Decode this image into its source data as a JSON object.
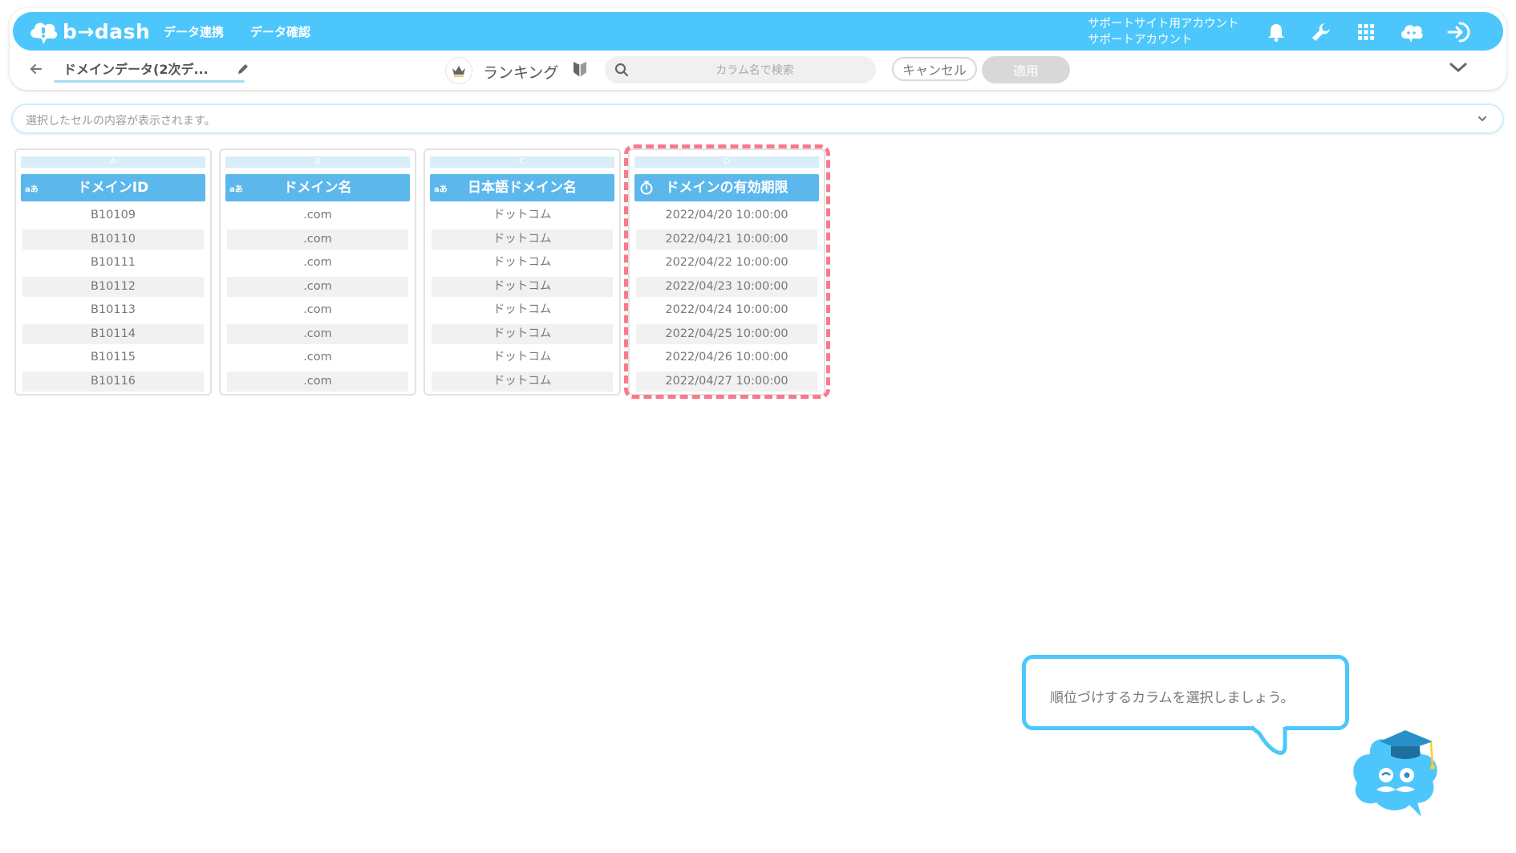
{
  "app": {
    "brand": "b→dash"
  },
  "nav": [
    {
      "label": "データ連携"
    },
    {
      "label": "データ確認"
    }
  ],
  "account": {
    "line1": "サポートサイト用アカウント",
    "line2": "サポートアカウント"
  },
  "header_icons": [
    "bell-icon",
    "wrench-icon",
    "grid-icon",
    "support-chat-icon",
    "logout-icon"
  ],
  "toolbar": {
    "title": "ドメインデータ(2次デ...",
    "ranking_label": "ランキング",
    "search_placeholder": "カラム名で検索",
    "cancel_label": "キャンセル",
    "apply_label": "適用"
  },
  "cell_bar": {
    "text": "選択したセルの内容が表示されます。"
  },
  "columns": [
    {
      "letter": "A",
      "type": "aあ",
      "name": "ドメインID",
      "cells": [
        "B10109",
        "B10110",
        "B10111",
        "B10112",
        "B10113",
        "B10114",
        "B10115",
        "B10116"
      ]
    },
    {
      "letter": "B",
      "type": "aあ",
      "name": "ドメイン名",
      "cells": [
        ".com",
        ".com",
        ".com",
        ".com",
        ".com",
        ".com",
        ".com",
        ".com"
      ]
    },
    {
      "letter": "C",
      "type": "aあ",
      "name": "日本語ドメイン名",
      "cells": [
        "ドットコム",
        "ドットコム",
        "ドットコム",
        "ドットコム",
        "ドットコム",
        "ドットコム",
        "ドットコム",
        "ドットコム"
      ]
    },
    {
      "letter": "D",
      "type": "timer",
      "name": "ドメインの有効期限",
      "cells": [
        "2022/04/20 10:00:00",
        "2022/04/21 10:00:00",
        "2022/04/22 10:00:00",
        "2022/04/23 10:00:00",
        "2022/04/24 10:00:00",
        "2022/04/25 10:00:00",
        "2022/04/26 10:00:00",
        "2022/04/27 10:00:00"
      ]
    }
  ],
  "tutorial": {
    "message": "順位づけするカラムを選択しましょう。"
  },
  "colors": {
    "brand": "#4dc7fb",
    "column_header": "#5cb7ec",
    "highlight": "#f97a8a"
  }
}
